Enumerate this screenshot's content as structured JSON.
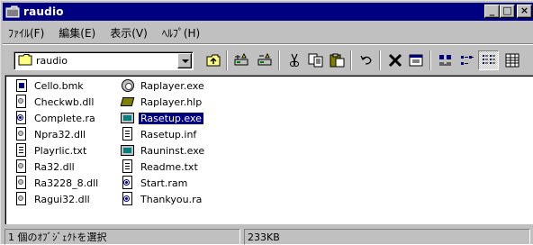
{
  "window": {
    "title": "raudio",
    "buttons": {
      "minimize": "_",
      "maximize": "□",
      "close": "×"
    }
  },
  "menu": [
    {
      "label": "ﾌｧｲﾙ(F)"
    },
    {
      "label": "編集(E)"
    },
    {
      "label": "表示(V)"
    },
    {
      "label": "ﾍﾙﾌﾟ(H)"
    }
  ],
  "toolbar": {
    "folder_combo": {
      "value": "raudio",
      "icon": "folder-icon"
    },
    "buttons": [
      {
        "name": "up-folder",
        "icon": "up-folder-icon"
      },
      {
        "name": "map-network-drive",
        "icon": "map-drive-icon"
      },
      {
        "name": "disconnect-network-drive",
        "icon": "disconnect-drive-icon"
      },
      {
        "name": "cut",
        "icon": "scissors-icon"
      },
      {
        "name": "copy",
        "icon": "copy-icon"
      },
      {
        "name": "paste",
        "icon": "paste-icon"
      },
      {
        "name": "undo",
        "icon": "undo-icon"
      },
      {
        "name": "delete",
        "icon": "delete-x-icon"
      },
      {
        "name": "properties",
        "icon": "properties-icon"
      },
      {
        "name": "large-icons",
        "icon": "large-icons-icon"
      },
      {
        "name": "small-icons",
        "icon": "small-icons-icon"
      },
      {
        "name": "list",
        "icon": "list-view-icon"
      },
      {
        "name": "details",
        "icon": "details-view-icon"
      }
    ]
  },
  "files": [
    {
      "name": "Cello.bmk",
      "icon": "bookmark-file-icon",
      "selected": false
    },
    {
      "name": "Checkwb.dll",
      "icon": "dll-file-icon",
      "selected": false
    },
    {
      "name": "Complete.ra",
      "icon": "realaudio-file-icon",
      "selected": false
    },
    {
      "name": "Npra32.dll",
      "icon": "dll-file-icon",
      "selected": false
    },
    {
      "name": "Playrlic.txt",
      "icon": "text-file-icon",
      "selected": false
    },
    {
      "name": "Ra32.dll",
      "icon": "dll-file-icon",
      "selected": false
    },
    {
      "name": "Ra3228_8.dll",
      "icon": "dll-file-icon",
      "selected": false
    },
    {
      "name": "Ragui32.dll",
      "icon": "dll-file-icon",
      "selected": false
    },
    {
      "name": "Raplayer.exe",
      "icon": "realplayer-exe-icon",
      "selected": false
    },
    {
      "name": "Raplayer.hlp",
      "icon": "help-file-icon",
      "selected": false
    },
    {
      "name": "Rasetup.exe",
      "icon": "setup-exe-icon",
      "selected": true
    },
    {
      "name": "Rasetup.inf",
      "icon": "inf-file-icon",
      "selected": false
    },
    {
      "name": "Rauninst.exe",
      "icon": "setup-exe-icon",
      "selected": false
    },
    {
      "name": "Readme.txt",
      "icon": "text-file-icon",
      "selected": false
    },
    {
      "name": "Start.ram",
      "icon": "realaudio-file-icon",
      "selected": false
    },
    {
      "name": "Thankyou.ra",
      "icon": "realaudio-file-icon",
      "selected": false
    }
  ],
  "status": {
    "selection": "1 個のｵﾌﾞｼﾞｪｸﾄを選択",
    "size": "233KB"
  }
}
